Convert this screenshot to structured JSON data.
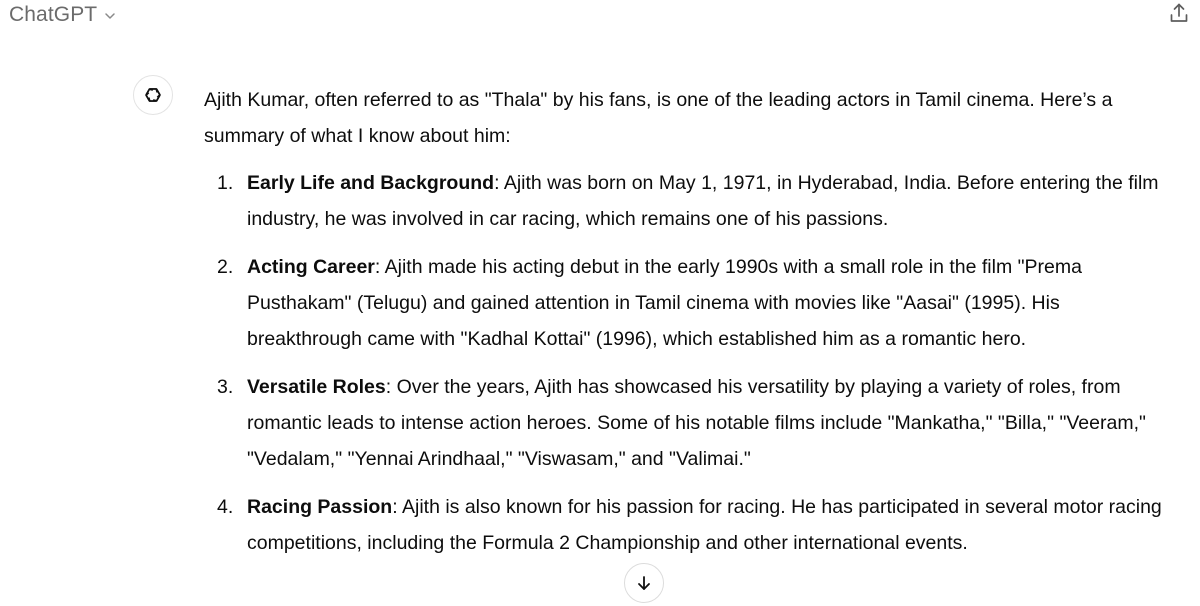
{
  "header": {
    "model_name": "ChatGPT",
    "chevron_icon": "chevron-down-icon",
    "share_icon": "share-icon"
  },
  "message": {
    "avatar_icon": "openai-logo-icon",
    "intro": "Ajith Kumar, often referred to as \"Thala\" by his fans, is one of the leading actors in Tamil cinema. Here’s a summary of what I know about him:",
    "points": [
      {
        "number": "1.",
        "term": "Early Life and Background",
        "text": ": Ajith was born on May 1, 1971, in Hyderabad, India. Before entering the film industry, he was involved in car racing, which remains one of his passions."
      },
      {
        "number": "2.",
        "term": "Acting Career",
        "text": ": Ajith made his acting debut in the early 1990s with a small role in the film \"Prema Pusthakam\" (Telugu) and gained attention in Tamil cinema with movies like \"Aasai\" (1995). His breakthrough came with \"Kadhal Kottai\" (1996), which established him as a romantic hero."
      },
      {
        "number": "3.",
        "term": "Versatile Roles",
        "text": ": Over the years, Ajith has showcased his versatility by playing a variety of roles, from romantic leads to intense action heroes. Some of his notable films include \"Mankatha,\" \"Billa,\" \"Veeram,\" \"Vedalam,\" \"Yennai Arindhaal,\" \"Viswasam,\" and \"Valimai.\""
      },
      {
        "number": "4.",
        "term": "Racing Passion",
        "text": ": Ajith is also known for his passion for racing. He has participated in several motor racing competitions, including the Formula 2 Championship and other international events."
      }
    ]
  },
  "scroll_button": {
    "icon": "arrow-down-icon"
  },
  "colors": {
    "text": "#0d0d0d",
    "muted": "#6b6b6b",
    "border": "#e3e3e3",
    "background": "#ffffff"
  }
}
